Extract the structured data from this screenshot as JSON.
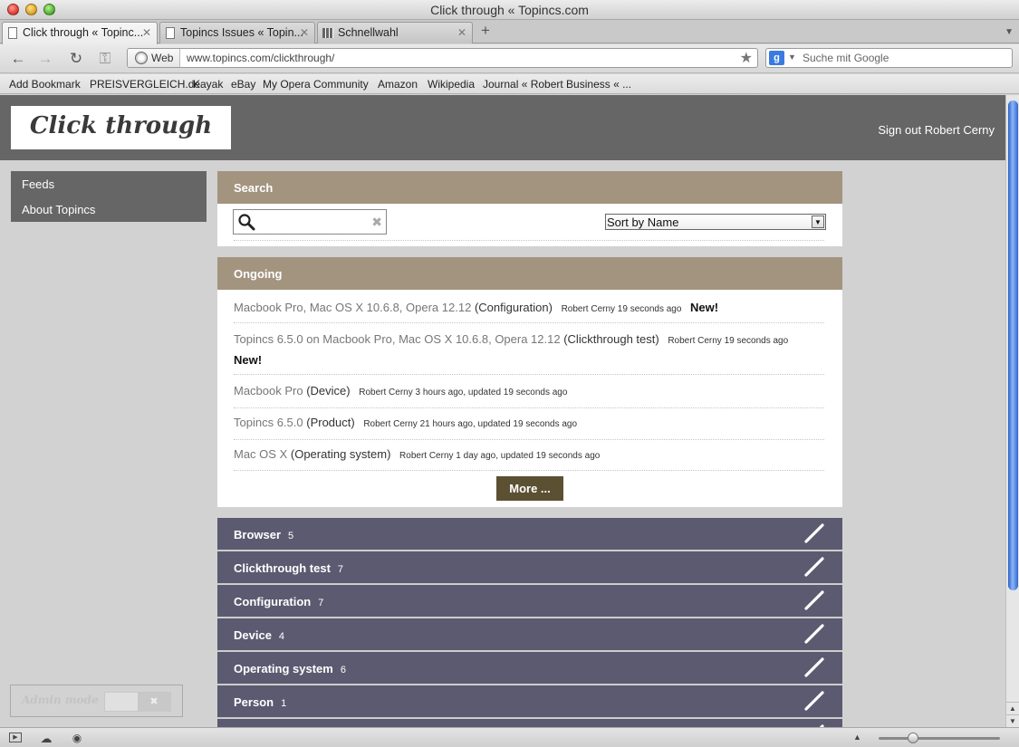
{
  "window": {
    "title": "Click through « Topincs.com"
  },
  "tabs": [
    {
      "label": "Click through « Topinc...",
      "active": true
    },
    {
      "label": "Topincs Issues « Topin...",
      "active": false
    },
    {
      "label": "Schnellwahl",
      "active": false
    }
  ],
  "toolbar": {
    "address_mode": "Web",
    "url": "www.topincs.com/clickthrough/",
    "search_placeholder": "Suche mit Google"
  },
  "bookmarks": [
    "Add Bookmark",
    "PREISVERGLEICH.de",
    "Kayak",
    "eBay",
    "My Opera Community",
    "Amazon",
    "Wikipedia",
    "Journal « Robert Business « ..."
  ],
  "site": {
    "logo": "Click through",
    "signout": "Sign out Robert Cerny",
    "nav": [
      "Feeds",
      "About Topincs"
    ],
    "admin_mode": "Admin mode"
  },
  "search_panel": {
    "heading": "Search",
    "input_value": "",
    "sort_value": "Sort by Name"
  },
  "ongoing": {
    "heading": "Ongoing",
    "items": [
      {
        "title": "Macbook Pro, Mac OS X 10.6.8, Opera 12.12",
        "kind": "(Configuration)",
        "meta": "Robert Cerny 19 seconds ago",
        "badge": "New!"
      },
      {
        "title": "Topincs 6.5.0 on Macbook Pro, Mac OS X 10.6.8, Opera 12.12",
        "kind": "(Clickthrough test)",
        "meta": "Robert Cerny 19 seconds ago",
        "badge": "New!"
      },
      {
        "title": "Macbook Pro",
        "kind": "(Device)",
        "meta": "Robert Cerny 3 hours ago, updated 19 seconds ago",
        "badge": ""
      },
      {
        "title": "Topincs 6.5.0",
        "kind": "(Product)",
        "meta": "Robert Cerny 21 hours ago, updated 19 seconds ago",
        "badge": ""
      },
      {
        "title": "Mac OS X",
        "kind": "(Operating system)",
        "meta": "Robert Cerny 1 day ago, updated 19 seconds ago",
        "badge": ""
      }
    ],
    "more_label": "More ..."
  },
  "categories": [
    {
      "name": "Browser",
      "count": "5"
    },
    {
      "name": "Clickthrough test",
      "count": "7"
    },
    {
      "name": "Configuration",
      "count": "7"
    },
    {
      "name": "Device",
      "count": "4"
    },
    {
      "name": "Operating system",
      "count": "6"
    },
    {
      "name": "Person",
      "count": "1"
    }
  ],
  "colors": {
    "header_bg": "#666666",
    "panel_head": "#a39480",
    "category_bg": "#5c5a70",
    "more_button": "#5c5033"
  },
  "icons": {
    "search": "magnifier-icon",
    "edit": "pencil-icon",
    "clear": "clear-x-icon"
  }
}
